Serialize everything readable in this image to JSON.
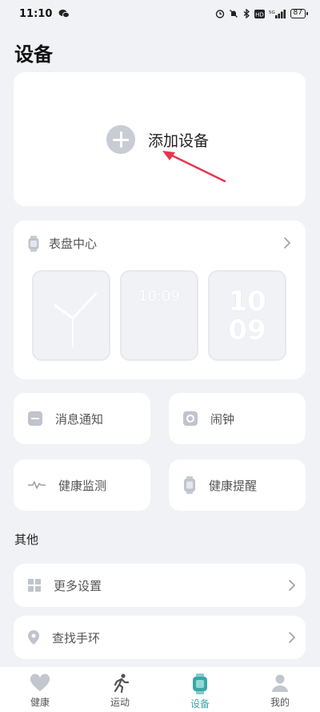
{
  "status_bar": {
    "time": "11:10",
    "network_speed": "5G",
    "battery": "87"
  },
  "page": {
    "title": "设备"
  },
  "add_device": {
    "label": "添加设备",
    "icon": "plus-circle-icon"
  },
  "dial_center": {
    "title": "表盘中心",
    "dials": [
      {
        "type": "analog"
      },
      {
        "type": "digital",
        "time": "10:09"
      },
      {
        "type": "big-digits",
        "top": "10",
        "bottom": "09"
      }
    ]
  },
  "features": [
    {
      "label": "消息通知",
      "icon": "message-icon"
    },
    {
      "label": "闹钟",
      "icon": "alarm-icon"
    },
    {
      "label": "健康监测",
      "icon": "heart-rate-icon"
    },
    {
      "label": "健康提醒",
      "icon": "watch-icon"
    }
  ],
  "other": {
    "title": "其他",
    "items": [
      {
        "label": "更多设置",
        "icon": "grid-icon"
      },
      {
        "label": "查找手环",
        "icon": "location-icon"
      }
    ]
  },
  "bottom_nav": {
    "items": [
      {
        "label": "健康",
        "icon": "heart-icon"
      },
      {
        "label": "运动",
        "icon": "running-icon"
      },
      {
        "label": "设备",
        "icon": "watch-icon"
      },
      {
        "label": "我的",
        "icon": "person-icon"
      }
    ],
    "active_color": "#3aa6a8"
  }
}
